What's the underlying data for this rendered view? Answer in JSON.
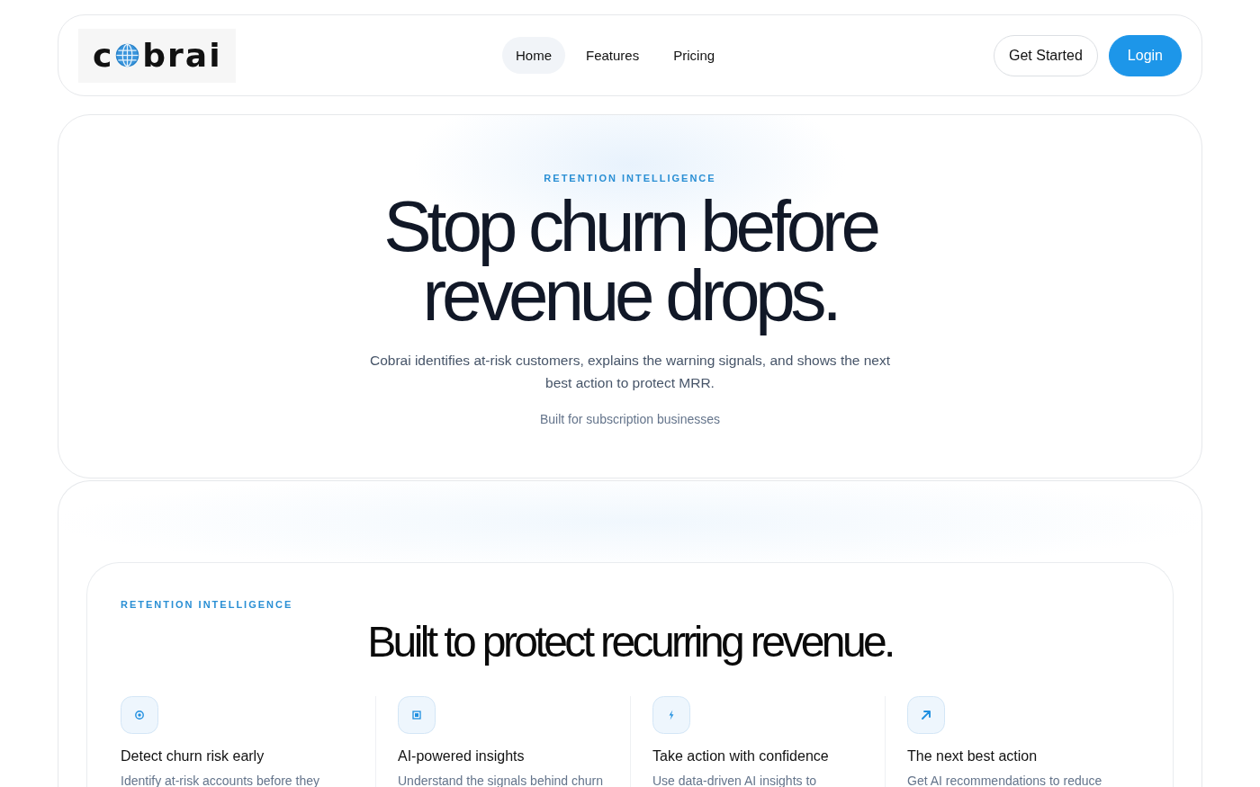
{
  "logo": {
    "prefix": "c",
    "suffix": "brai"
  },
  "nav": {
    "links": [
      {
        "label": "Home",
        "selected": true
      },
      {
        "label": "Features",
        "selected": false
      },
      {
        "label": "Pricing",
        "selected": false
      }
    ],
    "actions": [
      {
        "label": "Get Started",
        "kind": "outline"
      },
      {
        "label": "Login",
        "kind": "primary"
      }
    ]
  },
  "hero": {
    "eyebrow": "RETENTION INTELLIGENCE",
    "title": "Stop churn before revenue drops.",
    "subtitle": "Cobrai identifies at-risk customers, explains the warning signals, and shows the next best action to protect MRR.",
    "note": "Built for subscription businesses"
  },
  "features": {
    "eyebrow": "RETENTION INTELLIGENCE",
    "title": "Built to protect recurring revenue.",
    "items": [
      {
        "title": "Detect churn risk early",
        "description": "Identify at-risk accounts before they"
      },
      {
        "title": "AI-powered insights",
        "description": "Understand the signals behind churn"
      },
      {
        "title": "Take action with confidence",
        "description": "Use data-driven AI insights to"
      },
      {
        "title": "The next best action",
        "description": "Get AI recommendations to reduce"
      }
    ]
  }
}
